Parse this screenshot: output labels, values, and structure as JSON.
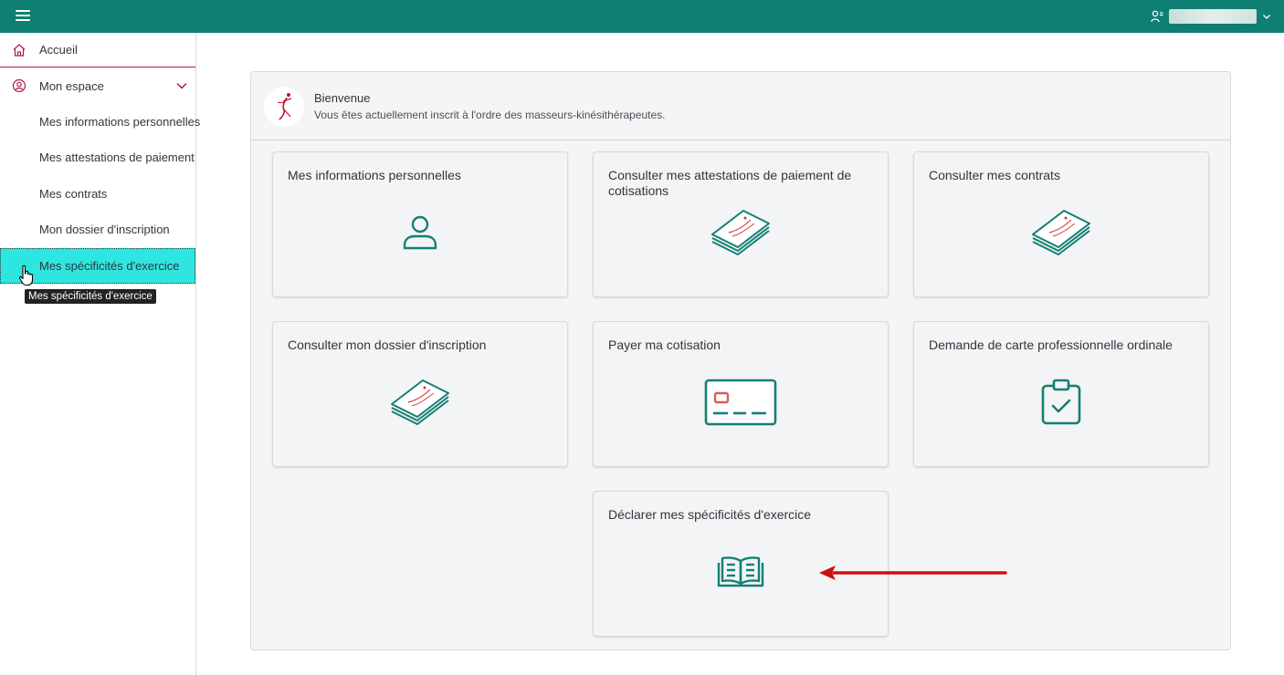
{
  "topbar": {
    "menu_icon": "hamburger-icon",
    "user_icon": "user-settings-icon",
    "user_name": "",
    "chevron_icon": "chevron-down-icon",
    "color": "#0f7f73"
  },
  "sidebar": {
    "home": {
      "label": "Accueil",
      "icon": "home-icon"
    },
    "space": {
      "label": "Mon espace",
      "icon": "user-circle-icon",
      "expanded": true
    },
    "items": [
      {
        "label": "Mes informations personnelles"
      },
      {
        "label": "Mes attestations de paiement"
      },
      {
        "label": "Mes contrats"
      },
      {
        "label": "Mon dossier d'inscription"
      },
      {
        "label": "Mes spécificités d'exercice",
        "active": true
      }
    ],
    "tooltip": "Mes spécificités d'exercice",
    "active_color": "#2ee6df",
    "accent_color": "#b1184b"
  },
  "welcome": {
    "title": "Bienvenue",
    "subtitle": "Vous êtes actuellement inscrit à l'ordre des masseurs-kinésithérapeutes."
  },
  "tiles": [
    {
      "title": "Mes informations personnelles",
      "icon": "person-icon"
    },
    {
      "title": "Consulter mes attestations de paiement de cotisations",
      "icon": "documents-stack-icon"
    },
    {
      "title": "Consulter mes contrats",
      "icon": "documents-stack-icon"
    },
    {
      "title": "Consulter mon dossier d'inscription",
      "icon": "documents-stack-icon"
    },
    {
      "title": "Payer ma cotisation",
      "icon": "credit-card-icon"
    },
    {
      "title": "Demande de carte professionnelle ordinale",
      "icon": "clipboard-check-icon"
    },
    {
      "title": "Déclarer mes spécificités d'exercice",
      "icon": "open-book-icon"
    }
  ],
  "colors": {
    "icon": "#138073",
    "annotation_arrow": "#cc1111"
  }
}
